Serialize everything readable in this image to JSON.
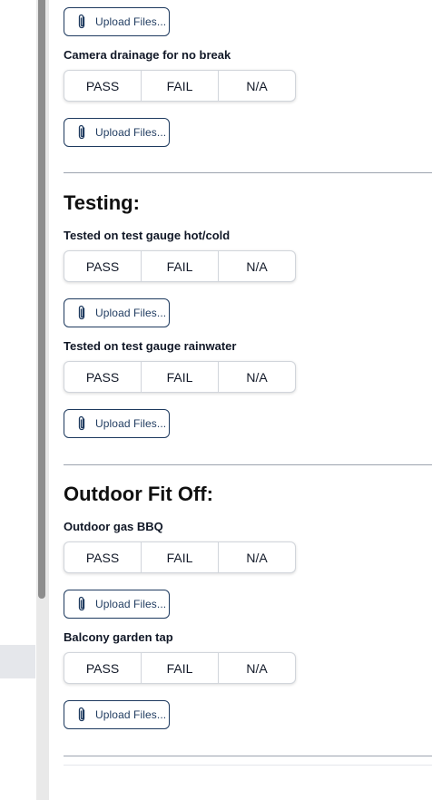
{
  "upload_label": "Upload Files...",
  "options": {
    "pass": "PASS",
    "fail": "FAIL",
    "na": "N/A"
  },
  "top_item": {
    "label": "Camera drainage for no break"
  },
  "testing": {
    "heading": "Testing:",
    "items": [
      {
        "label": "Tested on test gauge hot/cold"
      },
      {
        "label": "Tested on test gauge rainwater"
      }
    ]
  },
  "outdoor": {
    "heading": "Outdoor Fit Off:",
    "items": [
      {
        "label": "Outdoor gas BBQ"
      },
      {
        "label": "Balcony garden tap"
      }
    ]
  }
}
